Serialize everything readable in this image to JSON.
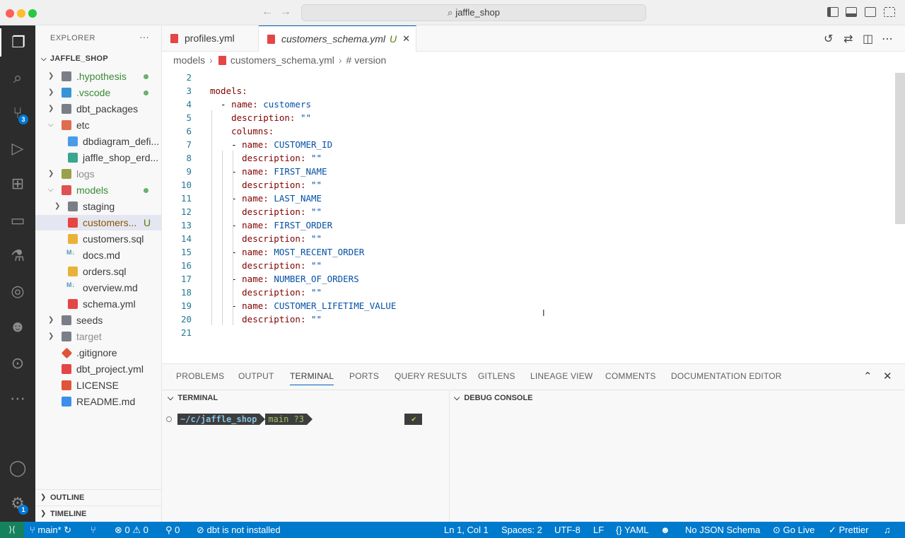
{
  "window": {
    "title": "jaffle_shop"
  },
  "activity": {
    "source_control_badge": "3",
    "accounts_badge": "1"
  },
  "sidebar": {
    "header": "EXPLORER",
    "more": "···",
    "root": "JAFFLE_SHOP",
    "items": [
      {
        "label": ".hypothesis"
      },
      {
        "label": ".vscode"
      },
      {
        "label": "dbt_packages"
      },
      {
        "label": "etc"
      },
      {
        "label": "dbdiagram_defi..."
      },
      {
        "label": "jaffle_shop_erd..."
      },
      {
        "label": "logs"
      },
      {
        "label": "models"
      },
      {
        "label": "staging"
      },
      {
        "label": "customers...",
        "status": "U"
      },
      {
        "label": "customers.sql"
      },
      {
        "label": "docs.md"
      },
      {
        "label": "orders.sql"
      },
      {
        "label": "overview.md"
      },
      {
        "label": "schema.yml"
      },
      {
        "label": "seeds"
      },
      {
        "label": "target"
      },
      {
        "label": ".gitignore"
      },
      {
        "label": "dbt_project.yml"
      },
      {
        "label": "LICENSE"
      },
      {
        "label": "README.md"
      }
    ],
    "md_icon": "M↓",
    "outline": "OUTLINE",
    "timeline": "TIMELINE"
  },
  "tabs": [
    {
      "label": "profiles.yml"
    },
    {
      "label": "customers_schema.yml",
      "status": "U"
    }
  ],
  "breadcrumb": {
    "folder": "models",
    "file": "customers_schema.yml",
    "symbol": "# version"
  },
  "editor": {
    "lines": [
      {
        "n": "2",
        "indent": "",
        "key": "",
        "val": ""
      },
      {
        "n": "3",
        "indent": "",
        "key": "models:",
        "val": ""
      },
      {
        "n": "4",
        "indent": "  - ",
        "key": "name:",
        "val": " customers"
      },
      {
        "n": "5",
        "indent": "    ",
        "key": "description:",
        "val": " \"\""
      },
      {
        "n": "6",
        "indent": "    ",
        "key": "columns:",
        "val": ""
      },
      {
        "n": "7",
        "indent": "    - ",
        "key": "name:",
        "val": " CUSTOMER_ID"
      },
      {
        "n": "8",
        "indent": "      ",
        "key": "description:",
        "val": " \"\""
      },
      {
        "n": "9",
        "indent": "    - ",
        "key": "name:",
        "val": " FIRST_NAME"
      },
      {
        "n": "10",
        "indent": "      ",
        "key": "description:",
        "val": " \"\""
      },
      {
        "n": "11",
        "indent": "    - ",
        "key": "name:",
        "val": " LAST_NAME"
      },
      {
        "n": "12",
        "indent": "      ",
        "key": "description:",
        "val": " \"\""
      },
      {
        "n": "13",
        "indent": "    - ",
        "key": "name:",
        "val": " FIRST_ORDER"
      },
      {
        "n": "14",
        "indent": "      ",
        "key": "description:",
        "val": " \"\""
      },
      {
        "n": "15",
        "indent": "    - ",
        "key": "name:",
        "val": " MOST_RECENT_ORDER"
      },
      {
        "n": "16",
        "indent": "      ",
        "key": "description:",
        "val": " \"\""
      },
      {
        "n": "17",
        "indent": "    - ",
        "key": "name:",
        "val": " NUMBER_OF_ORDERS"
      },
      {
        "n": "18",
        "indent": "      ",
        "key": "description:",
        "val": " \"\""
      },
      {
        "n": "19",
        "indent": "    - ",
        "key": "name:",
        "val": " CUSTOMER_LIFETIME_VALUE"
      },
      {
        "n": "20",
        "indent": "      ",
        "key": "description:",
        "val": " \"\""
      },
      {
        "n": "21",
        "indent": "",
        "key": "",
        "val": ""
      }
    ]
  },
  "panel": {
    "tabs": [
      "PROBLEMS",
      "OUTPUT",
      "TERMINAL",
      "PORTS",
      "QUERY RESULTS",
      "GITLENS",
      "LINEAGE VIEW",
      "COMMENTS",
      "DOCUMENTATION EDITOR"
    ],
    "active_tab": "TERMINAL",
    "terminal_header": "TERMINAL",
    "debug_header": "DEBUG CONSOLE",
    "prompt_path_prefix": "~/c/",
    "prompt_path_dir": "jaffle_shop",
    "prompt_branch": "main ?3",
    "prompt_status": "✔"
  },
  "status": {
    "branch": "main*",
    "errors": "0",
    "warnings": "0",
    "ports": "0",
    "dbt": "dbt is not installed",
    "position": "Ln 1, Col 1",
    "spaces": "Spaces: 2",
    "encoding": "UTF-8",
    "eol": "LF",
    "language": "YAML",
    "schema": "No JSON Schema",
    "golive": "Go Live",
    "prettier": "Prettier"
  },
  "colors": {
    "accent": "#007acc",
    "remote": "#16825d",
    "activity_bg": "#2c2c2c"
  }
}
